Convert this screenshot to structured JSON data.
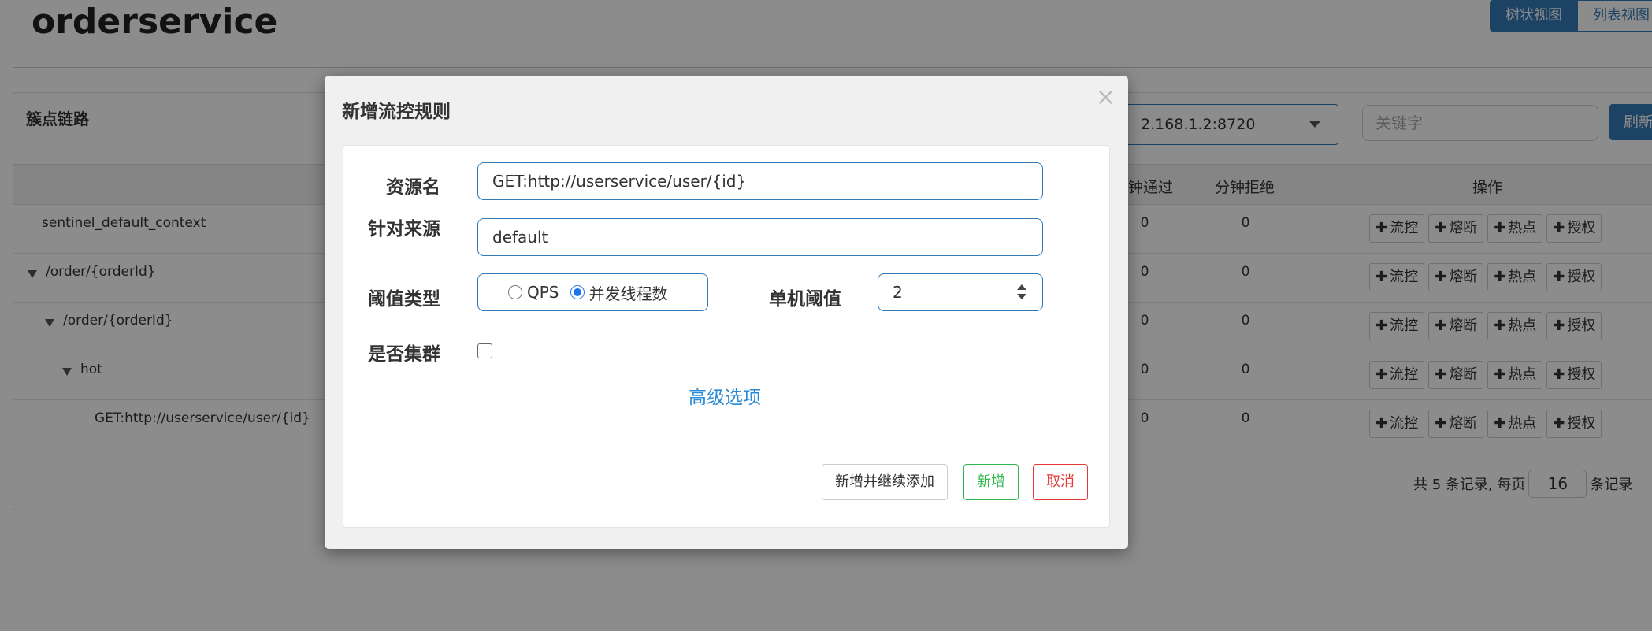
{
  "app": {
    "title": "orderservice",
    "view_tabs": [
      "树状视图",
      "列表视图"
    ]
  },
  "panel": {
    "title": "簇点链路",
    "machine_value": "2.168.1.2:8720",
    "keyword_placeholder": "关键字",
    "refresh_label": "刷新"
  },
  "table": {
    "headers": {
      "pass_per_min": "钟通过",
      "reject_per_min": "分钟拒绝",
      "operations": "操作"
    },
    "rows": [
      {
        "name": "sentinel_default_context",
        "pass": "0",
        "reject": "0"
      },
      {
        "name": "/order/{orderId}",
        "pass": "0",
        "reject": "0"
      },
      {
        "name": "/order/{orderId}",
        "pass": "0",
        "reject": "0"
      },
      {
        "name": "hot",
        "pass": "0",
        "reject": "0"
      },
      {
        "name": "GET:http://userservice/user/{id}",
        "pass": "0",
        "reject": "0"
      }
    ],
    "op_labels": [
      "流控",
      "熔断",
      "热点",
      "授权"
    ],
    "plus_glyph": "✚",
    "pager": {
      "prefix": "共 5 条记录, 每页",
      "page_size": "16",
      "suffix": "条记录"
    }
  },
  "modal": {
    "title": "新增流控规则",
    "close_glyph": "×",
    "fields": {
      "resource_label": "资源名",
      "resource_value": "GET:http://userservice/user/{id}",
      "origin_label": "针对来源",
      "origin_value": "default",
      "threshold_type_label": "阈值类型",
      "threshold_options": [
        "QPS",
        "并发线程数"
      ],
      "threshold_selected": "并发线程数",
      "single_threshold_label": "单机阈值",
      "single_threshold_value": "2",
      "cluster_label": "是否集群",
      "cluster_checked": false
    },
    "advanced_link": "高级选项",
    "buttons": {
      "add_continue": "新增并继续添加",
      "add": "新增",
      "cancel": "取消"
    }
  },
  "colors": {
    "primary": "#337ab7",
    "success": "#2db84d",
    "danger": "#e53935",
    "link": "#2a8bd8"
  }
}
